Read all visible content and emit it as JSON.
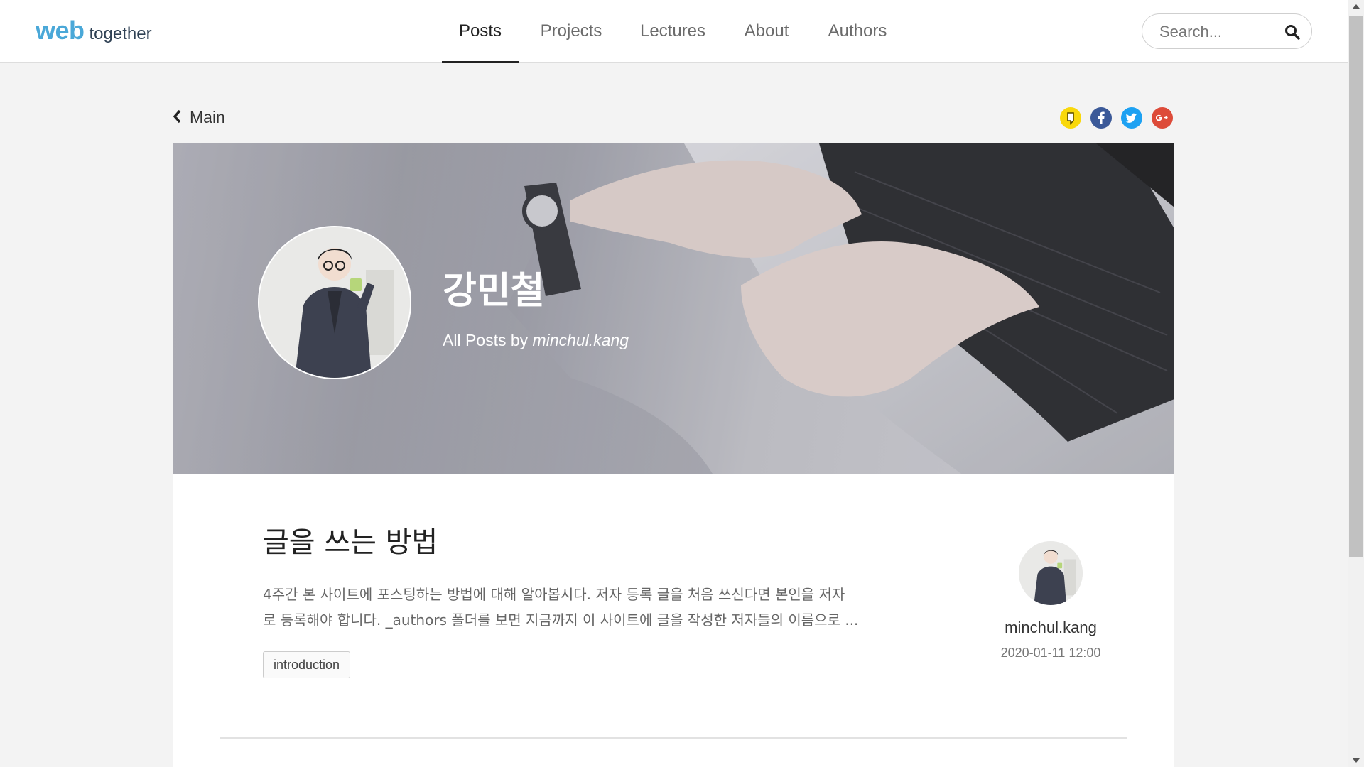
{
  "brand": {
    "logo_main": "web",
    "logo_sub": "together",
    "accent": "#4aa8d8"
  },
  "nav": {
    "items": [
      {
        "label": "Posts",
        "active": true
      },
      {
        "label": "Projects",
        "active": false
      },
      {
        "label": "Lectures",
        "active": false
      },
      {
        "label": "About",
        "active": false
      },
      {
        "label": "Authors",
        "active": false
      }
    ]
  },
  "search": {
    "placeholder": "Search...",
    "icon": "search-icon"
  },
  "back": {
    "label": "Main",
    "icon": "chevron-left-icon"
  },
  "share": [
    {
      "name": "kakaostory",
      "icon": "kakao-icon",
      "color": "#f9d80b"
    },
    {
      "name": "facebook",
      "icon": "facebook-icon",
      "color": "#3b5998"
    },
    {
      "name": "twitter",
      "icon": "twitter-icon",
      "color": "#1da1f2"
    },
    {
      "name": "google-plus",
      "icon": "google-plus-icon",
      "color": "#dd4b39"
    }
  ],
  "hero": {
    "name": "강민철",
    "subtitle_prefix": "All Posts by",
    "subtitle_author": "minchul.kang"
  },
  "post": {
    "title": "글을 쓰는 방법",
    "excerpt_line1": "4주간 본 사이트에 포스팅하는 방법에 대해 알아봅시다. 저자 등록 글을 처음 쓰신다면 본인을 저자",
    "excerpt_line2": "로 등록해야 합니다. _authors 폴더를 보면 지금까지 이 사이트에 글을 작성한 저자들의 이름으로 ...",
    "tags": [
      "introduction"
    ],
    "author": "minchul.kang",
    "date": "2020-01-11 12:00"
  }
}
